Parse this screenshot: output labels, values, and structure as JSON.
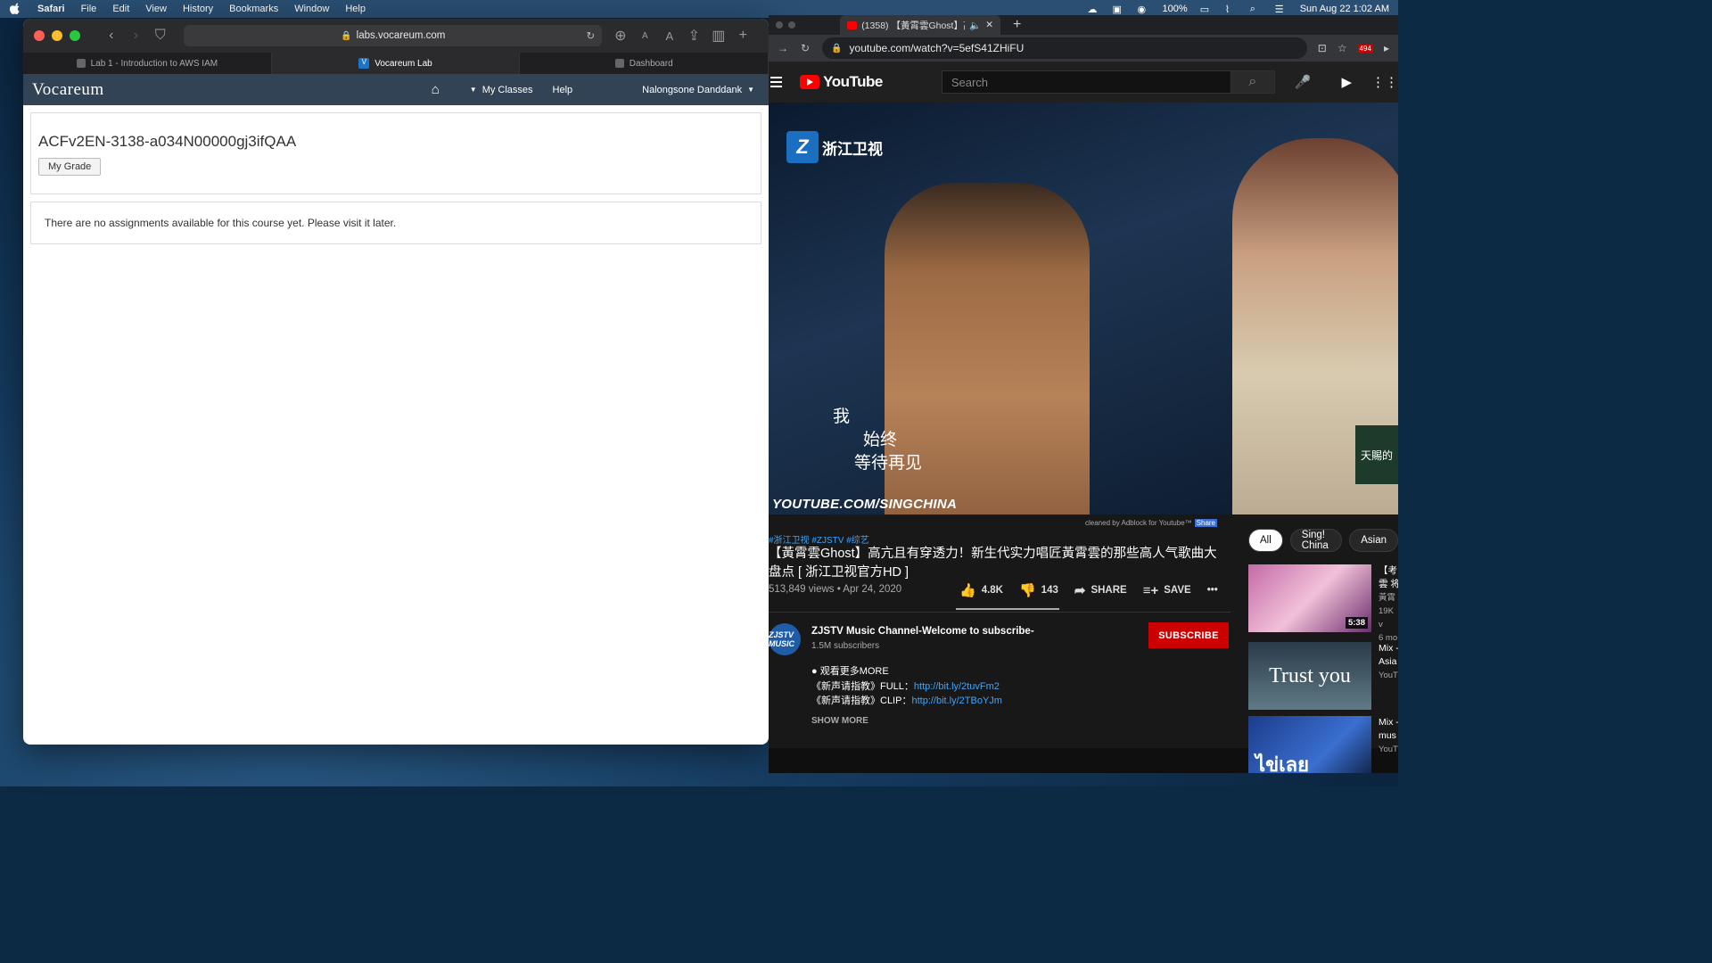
{
  "menubar": {
    "app": "Safari",
    "items": [
      "File",
      "Edit",
      "View",
      "History",
      "Bookmarks",
      "Window",
      "Help"
    ],
    "battery": "100%",
    "datetime": "Sun Aug 22  1:02 AM"
  },
  "safari": {
    "url": "labs.vocareum.com",
    "tabs": [
      {
        "label": "Lab 1 - Introduction to AWS IAM"
      },
      {
        "label": "Vocareum Lab"
      },
      {
        "label": "Dashboard"
      }
    ],
    "text_size_small": "A",
    "text_size_large": "A"
  },
  "vocareum": {
    "logo": "Vocareum",
    "nav": {
      "my_classes": "My Classes",
      "help": "Help",
      "user": "Nalongsone Danddank"
    },
    "course_title": "ACFv2EN-3138-a034N00000gj3ifQAA",
    "grade_button": "My Grade",
    "notice": "There are no assignments available for this course yet. Please visit it later."
  },
  "chrome": {
    "tab_title": "(1358) 【黃霄雲Ghost】高",
    "url": "youtube.com/watch?v=5efS41ZHiFU",
    "ext_badge": "494"
  },
  "youtube": {
    "logo": "YouTube",
    "search_placeholder": "Search",
    "video": {
      "station": "浙江卫视",
      "lyrics": [
        "我",
        "始终",
        "等待再见"
      ],
      "watermark": "YOUTUBE.COM/SINGCHINA",
      "corner_badge": "天賜的"
    },
    "adblock_note": "cleaned by Adblock for Youtube™",
    "adblock_share": "Share",
    "tags": "#浙江卫视 #ZJSTV #综艺",
    "title": "【黃霄雲Ghost】高亢且有穿透力！新生代实力唱匠黃霄雲的那些高人气歌曲大盘点 [ 浙江卫视官方HD ]",
    "meta": "513,849 views • Apr 24, 2020",
    "likes": "4.8K",
    "dislikes": "143",
    "share": "SHARE",
    "save": "SAVE",
    "more": "•••",
    "channel": {
      "avatar_text": "ZJSTV MUSIC",
      "name": "ZJSTV Music Channel-Welcome to subscribe-",
      "subs": "1.5M subscribers"
    },
    "subscribe": "SUBSCRIBE",
    "description": {
      "line1": "● 观看更多MORE",
      "line2_label": "《新声请指教》FULL：",
      "line2_link": "http://bit.ly/2tuvFm2",
      "line3_label": "《新声请指教》CLIP：",
      "line3_link": "http://bit.ly/2TBoYJm"
    },
    "show_more": "SHOW MORE",
    "chips": [
      "All",
      "Sing! China",
      "Asian"
    ],
    "recommended": [
      {
        "duration": "5:38",
        "title": "【考",
        "line2": "雲 将",
        "channel": "黃霄",
        "views": "19K v",
        "age": "6 mo"
      },
      {
        "duration": "",
        "thumb_text": "Trust you",
        "title": "Mix -",
        "line2": "Asia",
        "channel": "YouT"
      },
      {
        "duration": "",
        "thumb_text": "ไข่เลย",
        "title": "Mix -",
        "line2": "mus",
        "channel": "YouT"
      }
    ]
  }
}
